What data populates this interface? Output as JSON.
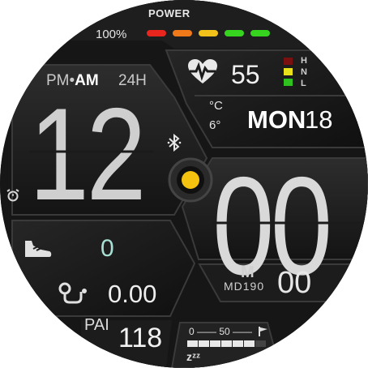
{
  "power": {
    "label": "POWER",
    "percent": "100%",
    "level": 1.0,
    "segment_colors": [
      "#e8261e",
      "#f07a1a",
      "#f2c21a",
      "#36d31f",
      "#36d31f"
    ]
  },
  "heart_rate": {
    "value": "55",
    "scale_labels": [
      "H",
      "N",
      "L"
    ],
    "scale_colors": [
      "#7a1010",
      "#e9e21a",
      "#2fc21f"
    ]
  },
  "time": {
    "ampm_prefix": "PM•",
    "ampm_active": "AM",
    "format_label": "24H",
    "hours": "12",
    "minutes": "00",
    "seconds": "00"
  },
  "weather": {
    "unit": "°C",
    "temperature": "6°"
  },
  "date": {
    "weekday": "MON",
    "day": "18"
  },
  "steps": {
    "value": "0"
  },
  "distance": {
    "value": "0.00"
  },
  "brand": {
    "logo": "M",
    "model": "MD190"
  },
  "pai": {
    "label": "PAI",
    "value": "118"
  },
  "sleep": {
    "scale_min": "0",
    "scale_mid": "50",
    "zz": "zᶻᶻ",
    "segments_filled": 6
  },
  "colors": {
    "accent": "#f5c20f",
    "background": "#1b1b1b"
  },
  "icons": {
    "heart": "heart-rate-icon",
    "bluetooth": "bluetooth-icon",
    "alarm": "alarm-icon",
    "steps": "shoe-icon",
    "distance": "route-icon",
    "sleep": "flag-icon"
  }
}
